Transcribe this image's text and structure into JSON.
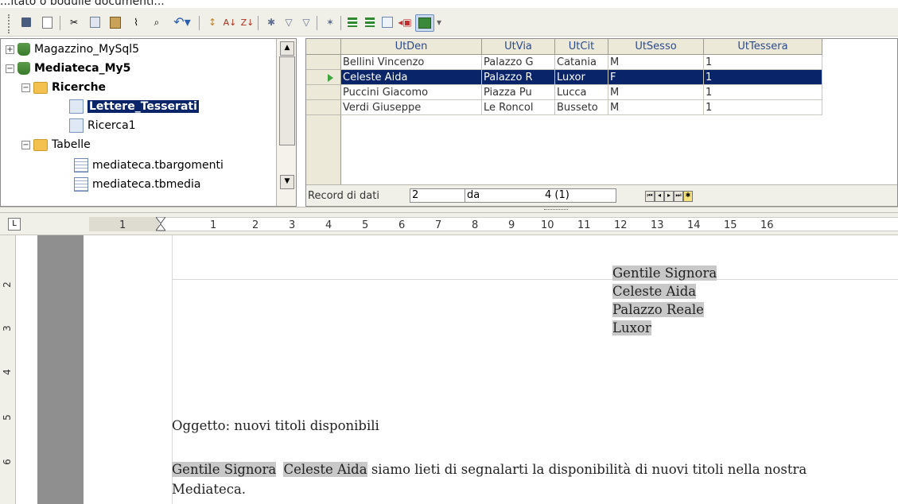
{
  "caption": "...itato o bodulle documenti...",
  "toolbar": {
    "buttons": [
      {
        "icon": "save-icon"
      },
      {
        "icon": "edit-icon"
      },
      {
        "icon": "cut-icon"
      },
      {
        "icon": "copy-icon"
      },
      {
        "icon": "paste-icon"
      },
      {
        "icon": "format-paintbrush-icon"
      },
      {
        "icon": "find-icon"
      },
      {
        "icon": "undo-icon"
      },
      {
        "icon": "sort-icon"
      },
      {
        "icon": "sort-ascending-icon"
      },
      {
        "icon": "sort-descending-icon"
      },
      {
        "icon": "autofilter-icon"
      },
      {
        "icon": "standard-filter-icon"
      },
      {
        "icon": "remove-filter-icon"
      },
      {
        "icon": "data-to-text-icon"
      },
      {
        "icon": "data-to-fields-icon"
      },
      {
        "icon": "mail-merge-icon"
      },
      {
        "icon": "source-icon"
      },
      {
        "icon": "explorer-toggle-icon"
      }
    ]
  },
  "navigator": {
    "items": [
      {
        "label": "Magazzino_MySql5",
        "level": 0,
        "expander": "+",
        "icon": "database-icon",
        "bold": false
      },
      {
        "label": "Mediateca_My5",
        "level": 0,
        "expander": "−",
        "icon": "database-icon",
        "bold": true
      },
      {
        "label": "Ricerche",
        "level": 1,
        "expander": "−",
        "icon": "folder-icon",
        "bold": true
      },
      {
        "label": "Lettere_Tesserati",
        "level": 2,
        "expander": "",
        "icon": "query-icon",
        "bold": true,
        "selected": true
      },
      {
        "label": "Ricerca1",
        "level": 2,
        "expander": "",
        "icon": "query-icon",
        "bold": false
      },
      {
        "label": "Tabelle",
        "level": 1,
        "expander": "−",
        "icon": "folder-icon",
        "bold": false
      },
      {
        "label": "mediateca.tbargomenti",
        "level": 2,
        "expander": "",
        "icon": "table-icon",
        "bold": false
      },
      {
        "label": "mediateca.tbmedia",
        "level": 2,
        "expander": "",
        "icon": "table-icon",
        "bold": false
      }
    ]
  },
  "grid": {
    "columns": [
      "UtDen",
      "UtVia",
      "UtCit",
      "UtSesso",
      "UtTessera"
    ],
    "rows": [
      [
        "Bellini Vincenzo",
        "Palazzo G",
        "Catania",
        "M",
        "1"
      ],
      [
        "Celeste Aida",
        "Palazzo R",
        "Luxor",
        "F",
        "1"
      ],
      [
        "Puccini Giacomo",
        "Piazza Pu",
        "Lucca",
        "M",
        "1"
      ],
      [
        "Verdi Giuseppe",
        "Le Roncol",
        "Busseto",
        "M",
        "1"
      ]
    ],
    "selected_row": 1,
    "status": {
      "label": "Record di dati",
      "current": "2",
      "of_label": "da",
      "total": "4 (1)"
    }
  },
  "ruler": {
    "corner": "L",
    "numbers": [
      "1",
      "1",
      "2",
      "3",
      "4",
      "5",
      "6",
      "7",
      "8",
      "9",
      "10",
      "11",
      "12",
      "13",
      "14",
      "15",
      "16"
    ],
    "vertical_numbers": [
      "2",
      "3",
      "4",
      "5",
      "6"
    ]
  },
  "document": {
    "address": [
      "Gentile Signora",
      "Celeste Aida",
      "Palazzo Reale",
      "Luxor"
    ],
    "subject": "Oggetto: nuovi titoli disponibili",
    "body_field1": "Gentile Signora",
    "body_field2": "Celeste Aida",
    "body_rest": " siamo lieti di segnalarti la disponibilità di nuovi titoli nella nostra",
    "body_line2": "Mediateca."
  }
}
